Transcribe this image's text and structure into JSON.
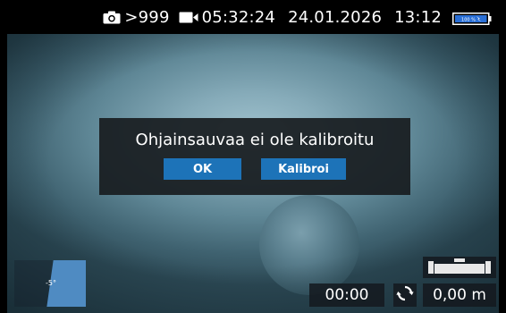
{
  "status_bar": {
    "photo_icon": "camera-icon",
    "photo_count": ">999",
    "video_icon": "video-camera-icon",
    "video_time": "05:32:24",
    "date": "24.01.2026",
    "time": "13:12",
    "battery_icon": "battery-charging-icon",
    "battery_label": "100 %"
  },
  "dialog": {
    "message": "Ohjainsauvaa ei ole kalibroitu",
    "ok_label": "OK",
    "calibrate_label": "Kalibroi"
  },
  "inclination": {
    "value_label": "-5°",
    "angle_deg": -5
  },
  "bottom_bar": {
    "level_icon": "level-icon",
    "timer": "00:00",
    "reset_icon": "refresh-icon",
    "distance": "0,00 m"
  },
  "colors": {
    "button_blue": "#1d73b8",
    "dialog_bg": "#181c20",
    "status_bg": "#000000",
    "inclination_fill": "#4f8bc2",
    "battery_fill": "#2a6fd6"
  }
}
